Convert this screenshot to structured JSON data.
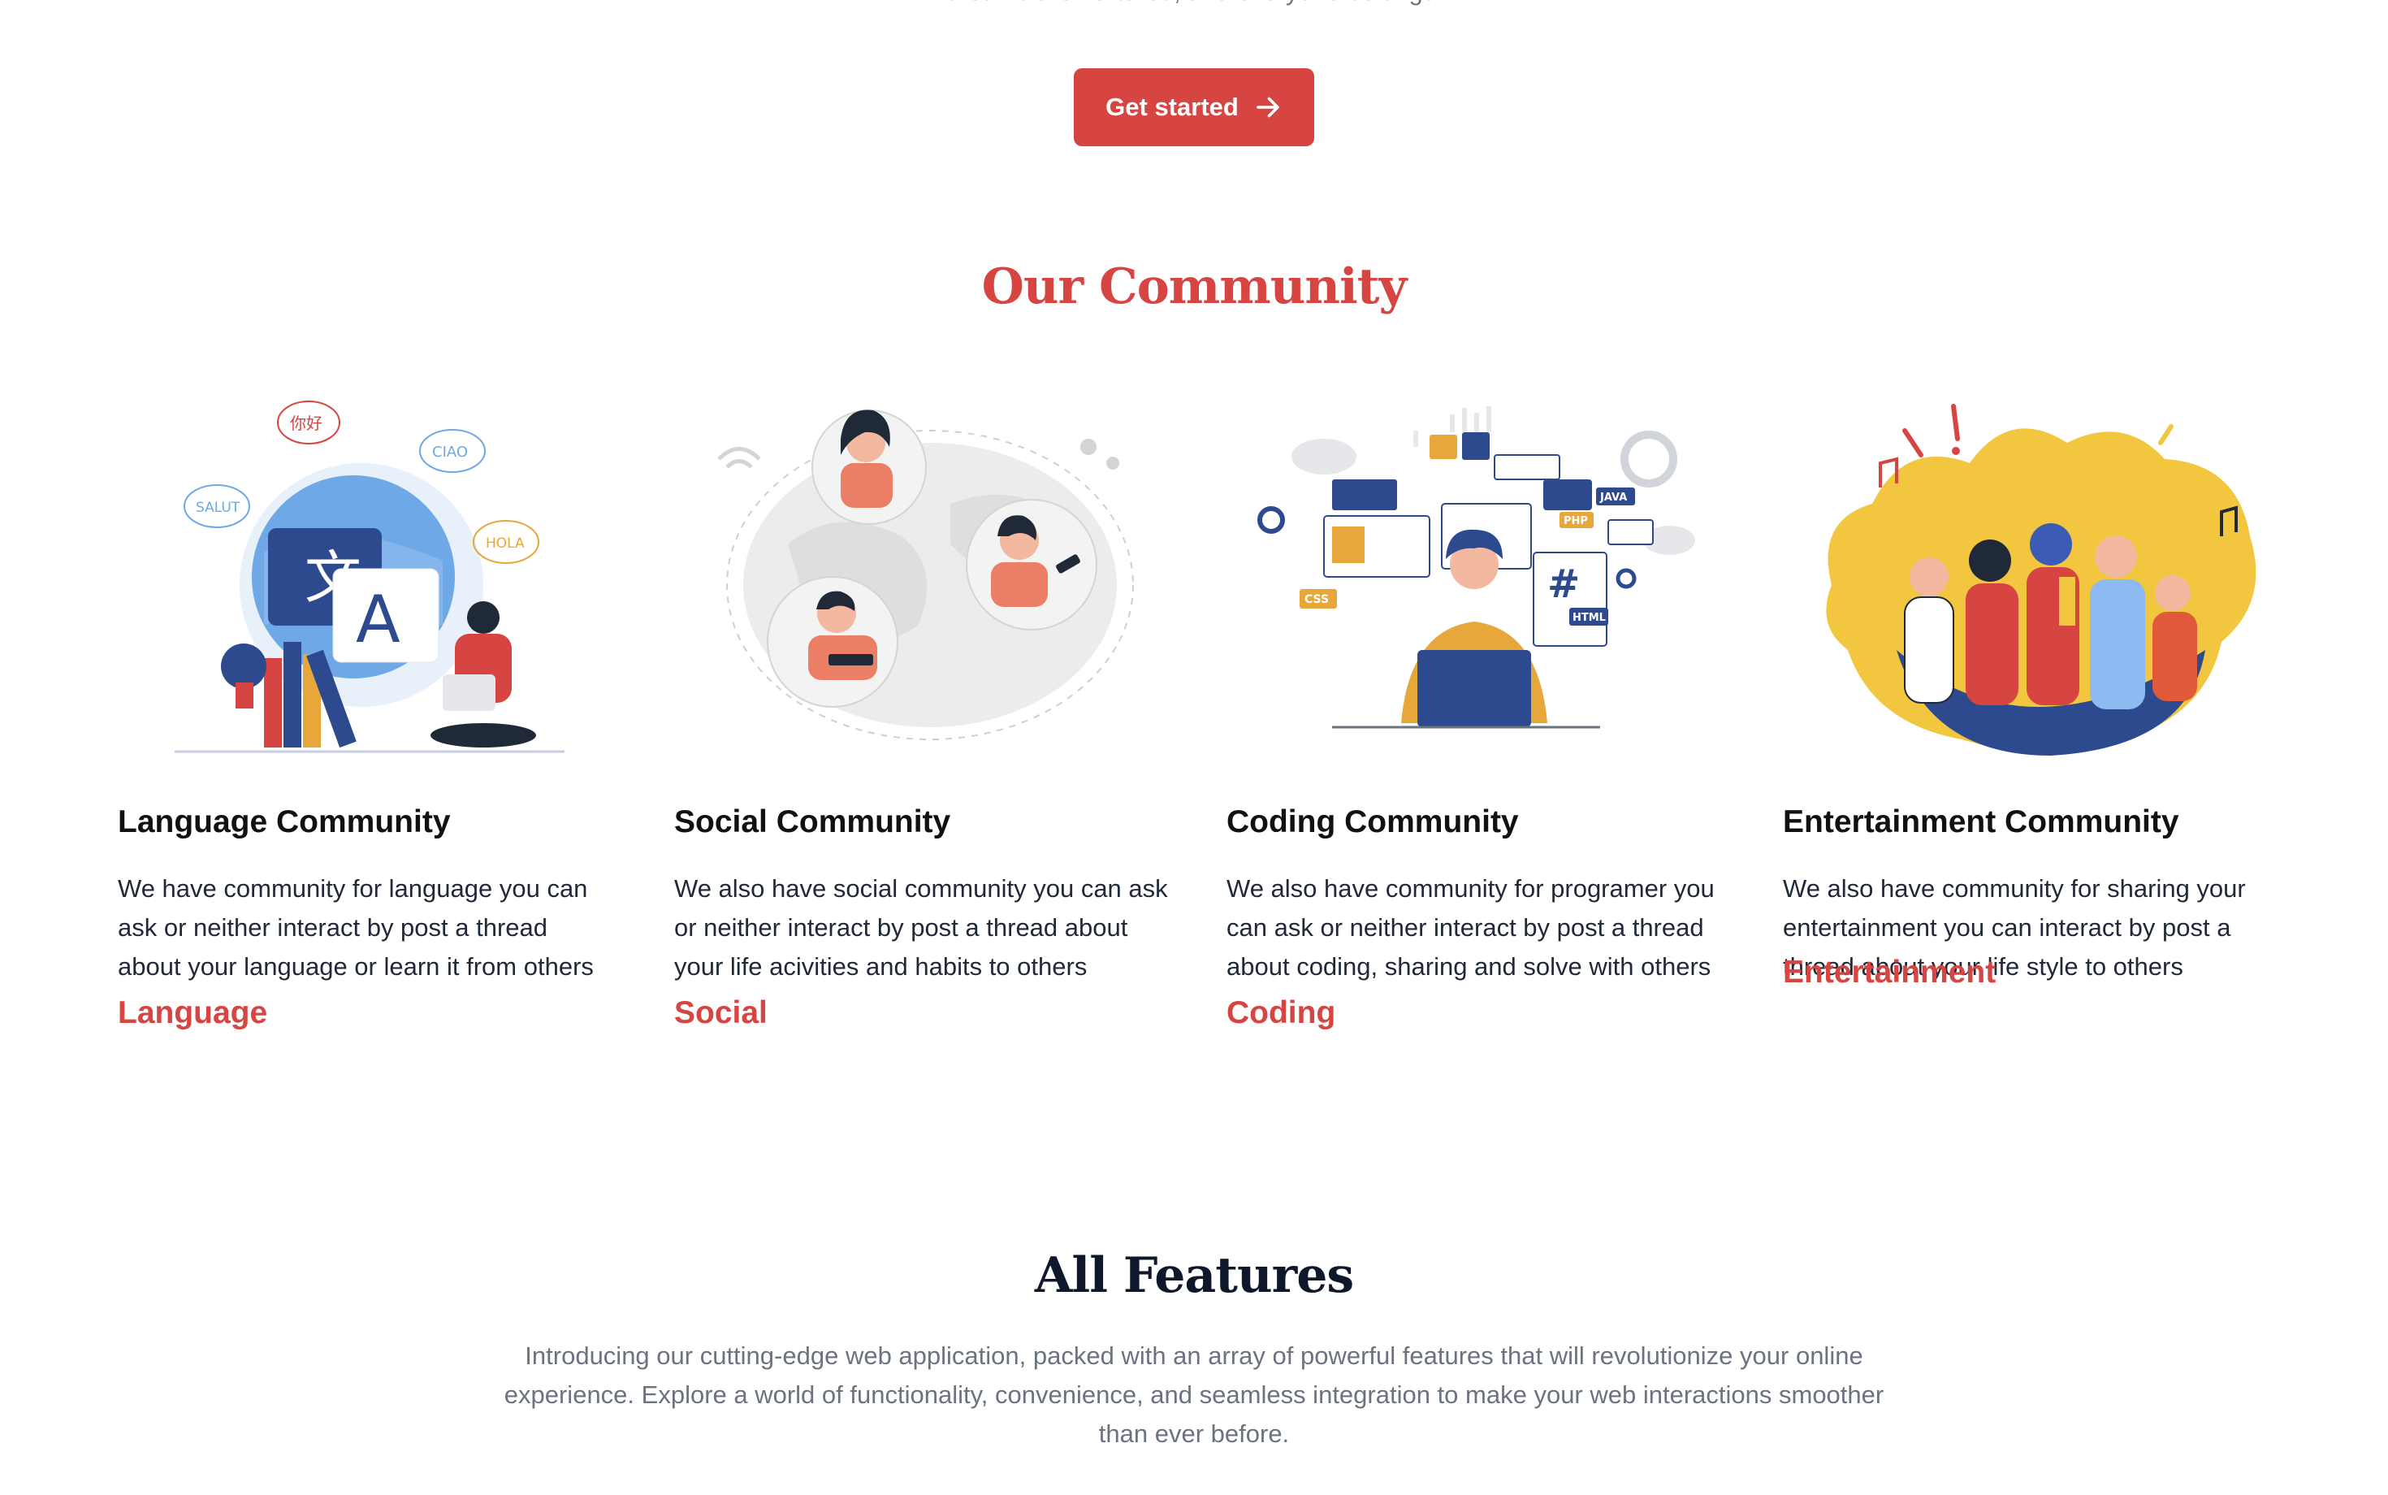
{
  "hero": {
    "tail_text": "dreams are nurtured, and everyone belongs.",
    "cta_label": "Get started"
  },
  "community": {
    "title": "Our Community",
    "cards": [
      {
        "heading": "Language Community",
        "description": "We have community for language you can ask or neither interact by post a thread about your language or learn it from others",
        "link": "Language",
        "art_labels": [
          "你好",
          "CIAO",
          "SALUT",
          "HOLA",
          "文",
          "A"
        ]
      },
      {
        "heading": "Social Community",
        "description": "We also have social community you can ask or neither interact by post a thread about your life acivities and habits to others",
        "link": "Social"
      },
      {
        "heading": "Coding Community",
        "description": "We also have community for programer you can ask or neither interact by post a thread about coding, sharing and solve with others",
        "link": "Coding",
        "art_labels": [
          "JAVA",
          "PHP",
          "CSS",
          "HTML",
          "#"
        ]
      },
      {
        "heading": "Entertainment Community",
        "description": "We also have community for sharing your entertainment you can interact by post a thread about your life style to others",
        "link": "Entertainment"
      }
    ]
  },
  "features": {
    "title": "All Features",
    "description": "Introducing our cutting-edge web application, packed with an array of powerful features that will revolutionize your online experience. Explore a world of functionality, convenience, and seamless integration to make your web interactions smoother than ever before."
  },
  "colors": {
    "accent": "#d64541",
    "heading_dark": "#0f172a",
    "muted": "#6b7280"
  }
}
